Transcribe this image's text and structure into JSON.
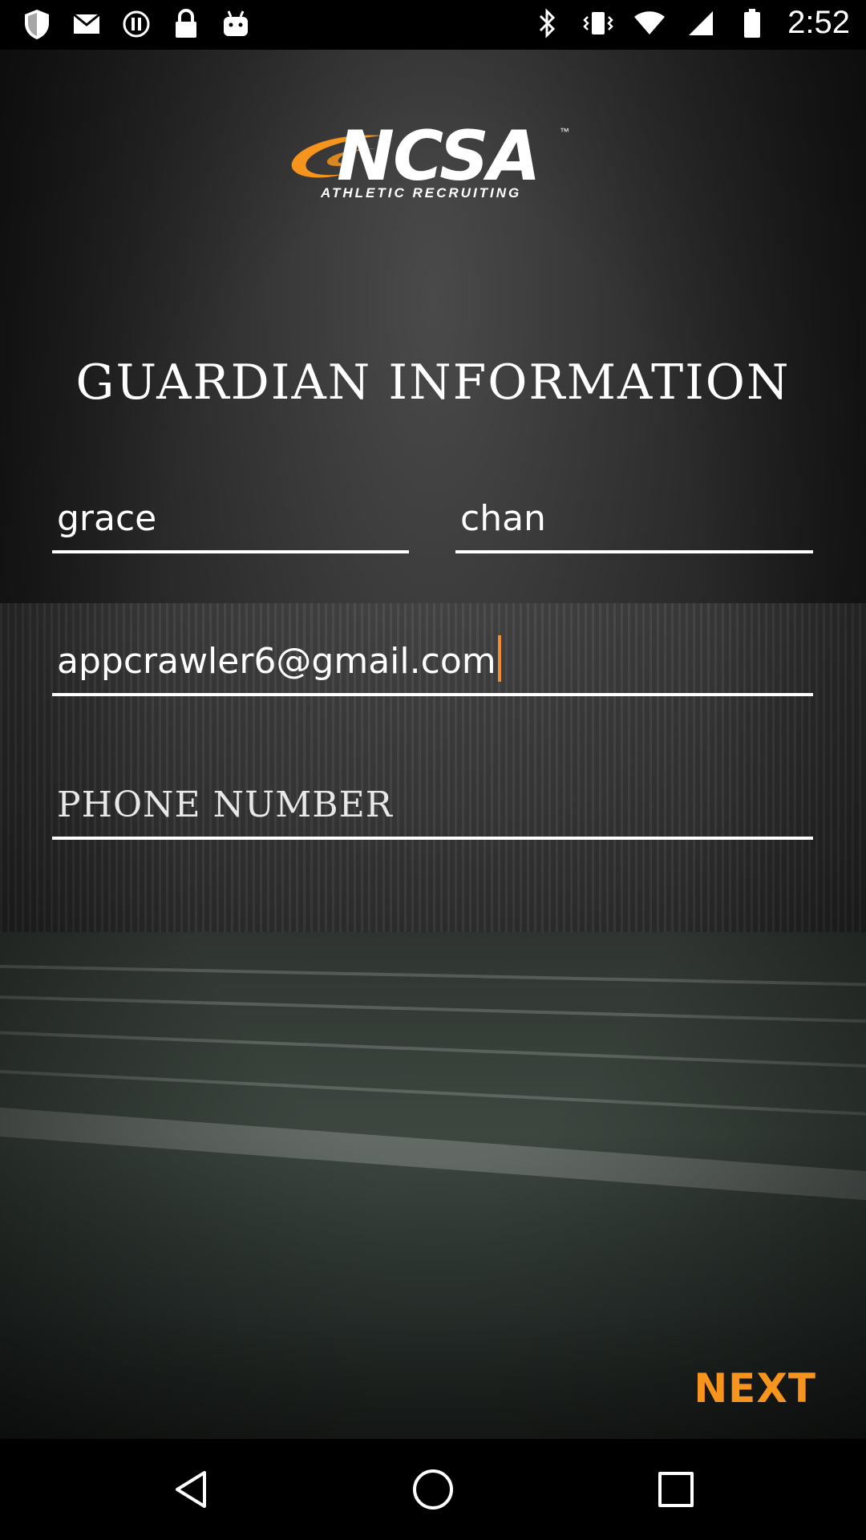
{
  "status_bar": {
    "time": "2:52",
    "left_icons": [
      "shield-icon",
      "mail-icon",
      "info-circle-icon",
      "lock-icon",
      "android-icon"
    ],
    "right_icons": [
      "bluetooth-icon",
      "vibrate-icon",
      "wifi-icon",
      "signal-icon",
      "battery-icon"
    ]
  },
  "logo": {
    "brand": "NCSA",
    "tm": "™",
    "tagline": "ATHLETIC RECRUITING",
    "accent_color": "#f7941d"
  },
  "form": {
    "title": "GUARDIAN INFORMATION",
    "first_name_value": "grace",
    "last_name_value": "chan",
    "email_value": "appcrawler6@gmail.com",
    "phone_placeholder": "PHONE NUMBER"
  },
  "actions": {
    "next_label": "NEXT"
  },
  "nav_bar": {
    "buttons": [
      "back-icon",
      "home-icon",
      "recents-icon"
    ]
  }
}
